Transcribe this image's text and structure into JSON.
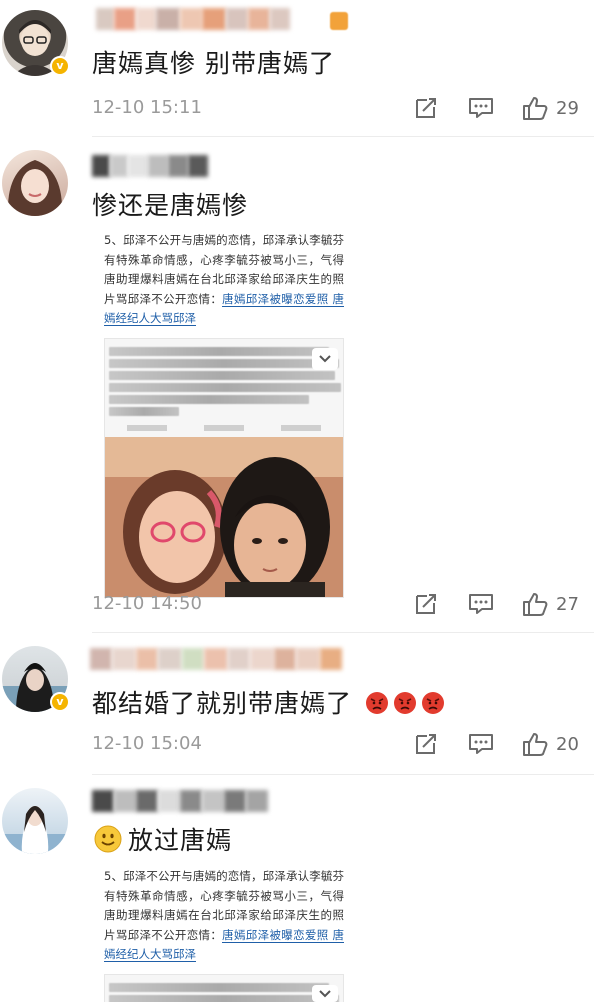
{
  "comments": [
    {
      "text": "唐嫣真惨 别带唐嫣了",
      "time": "12-10 15:11",
      "likes": "29"
    },
    {
      "text": "惨还是唐嫣惨",
      "time": "12-10 14:50",
      "likes": "27",
      "attachment": {
        "paragraph": "5、邱泽不公开与唐嫣的恋情，邱泽承认李毓芬有特殊革命情感，心疼李毓芬被骂小三，气得唐助理爆料唐嫣在台北邱泽家给邱泽庆生的照片骂邱泽不公开恋情：",
        "link": "唐嫣邱泽被曝恋爱照 唐嫣经纪人大骂邱泽"
      }
    },
    {
      "text": "都结婚了就别带唐嫣了",
      "time": "12-10 15:04",
      "likes": "20",
      "emoji_count": 3
    },
    {
      "text": "放过唐嫣",
      "attachment": {
        "paragraph": "5、邱泽不公开与唐嫣的恋情，邱泽承认李毓芬有特殊革命情感，心疼李毓芬被骂小三，气得唐助理爆料唐嫣在台北邱泽家给邱泽庆生的照片骂邱泽不公开恋情：",
        "link": "唐嫣邱泽被曝恋爱照 唐嫣经纪人大骂邱泽"
      }
    }
  ],
  "colors": {
    "time": "#9a9a9a",
    "link": "#1f5fa8",
    "badge": "#f5b400"
  },
  "icons": [
    "share-icon",
    "comment-icon",
    "like-icon",
    "smile-emoji-icon",
    "angry-emoji-icon",
    "collapse-chevron-icon"
  ]
}
